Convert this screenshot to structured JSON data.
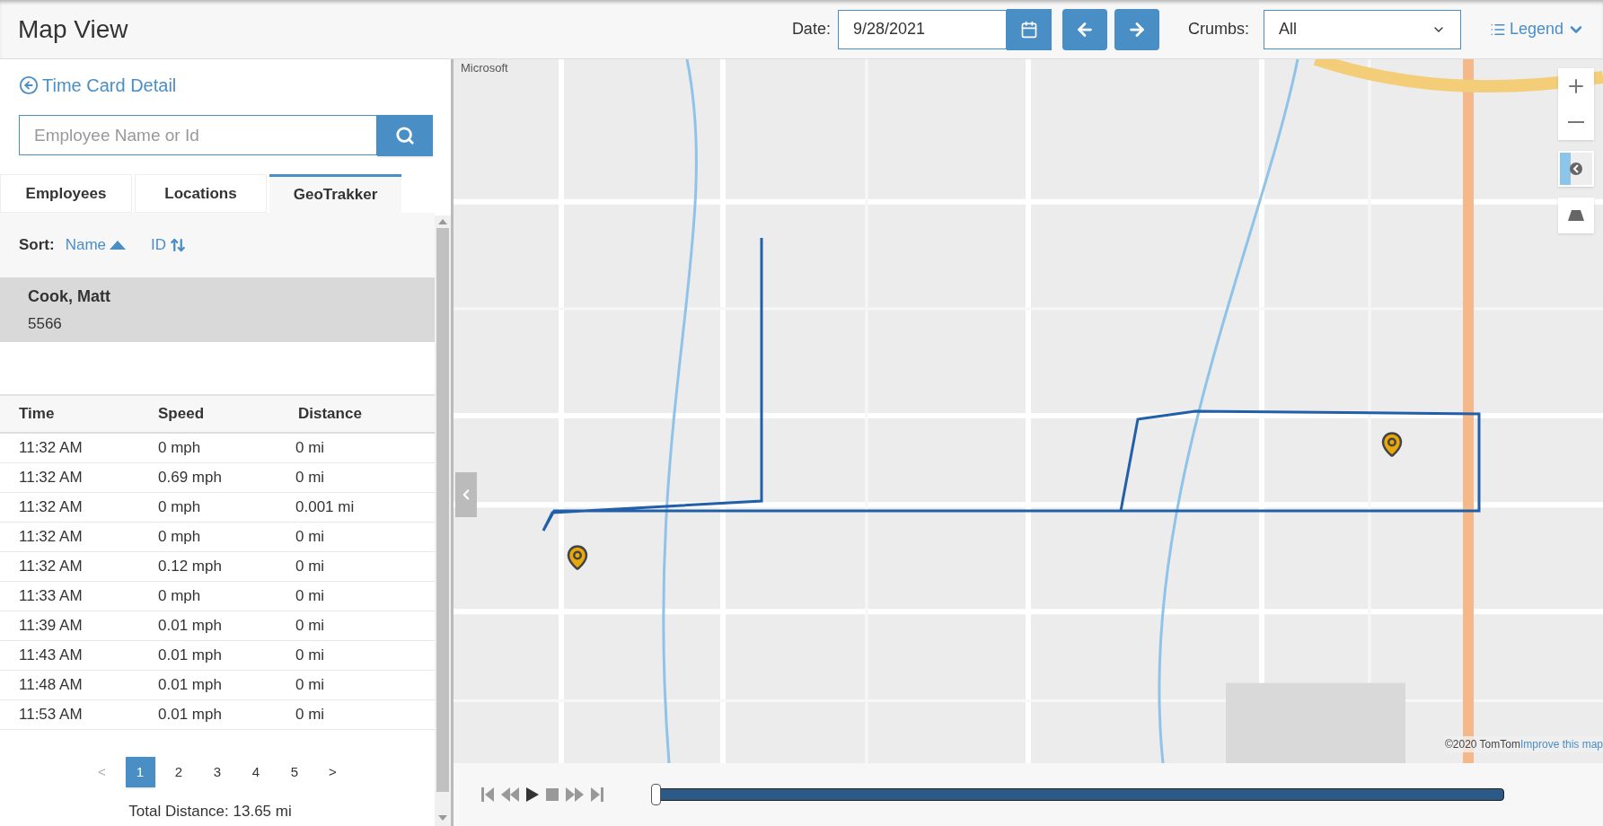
{
  "header": {
    "title": "Map View",
    "date_label": "Date:",
    "date_value": "9/28/2021",
    "crumbs_label": "Crumbs:",
    "crumbs_value": "All",
    "legend": "Legend"
  },
  "sidebar": {
    "back_link": "Time Card Detail",
    "search": {
      "placeholder": "Employee Name or Id"
    },
    "tabs": [
      {
        "label": "Employees",
        "selected": false
      },
      {
        "label": "Locations",
        "selected": false
      },
      {
        "label": "GeoTrakker",
        "selected": true
      }
    ],
    "sort": {
      "label": "Sort:",
      "options": [
        {
          "label": "Name",
          "kind": "asc"
        },
        {
          "label": "ID",
          "kind": "both"
        }
      ]
    },
    "employees": [
      {
        "name": "Cook, Matt",
        "id": "5566",
        "selected": true
      }
    ],
    "table": {
      "columns": [
        "Time",
        "Speed",
        "Distance"
      ],
      "rows": [
        [
          "11:32 AM",
          "0 mph",
          "0 mi"
        ],
        [
          "11:32 AM",
          "0.69 mph",
          "0 mi"
        ],
        [
          "11:32 AM",
          "0 mph",
          "0.001 mi"
        ],
        [
          "11:32 AM",
          "0 mph",
          "0 mi"
        ],
        [
          "11:32 AM",
          "0.12 mph",
          "0 mi"
        ],
        [
          "11:33 AM",
          "0 mph",
          "0 mi"
        ],
        [
          "11:39 AM",
          "0.01 mph",
          "0 mi"
        ],
        [
          "11:43 AM",
          "0.01 mph",
          "0 mi"
        ],
        [
          "11:48 AM",
          "0.01 mph",
          "0 mi"
        ],
        [
          "11:53 AM",
          "0.01 mph",
          "0 mi"
        ]
      ]
    },
    "pagination": {
      "prev": "<",
      "next": ">",
      "pages": [
        {
          "label": "1",
          "selected": true
        },
        {
          "label": "2",
          "selected": false
        },
        {
          "label": "3",
          "selected": false
        },
        {
          "label": "4",
          "selected": false
        },
        {
          "label": "5",
          "selected": false
        }
      ]
    },
    "total": "Total Distance: 13.65 mi"
  },
  "map": {
    "provider": "Microsoft",
    "attribution": "©2020 TomTom",
    "improve_link": "Improve this map"
  },
  "player": {
    "level": 0
  }
}
